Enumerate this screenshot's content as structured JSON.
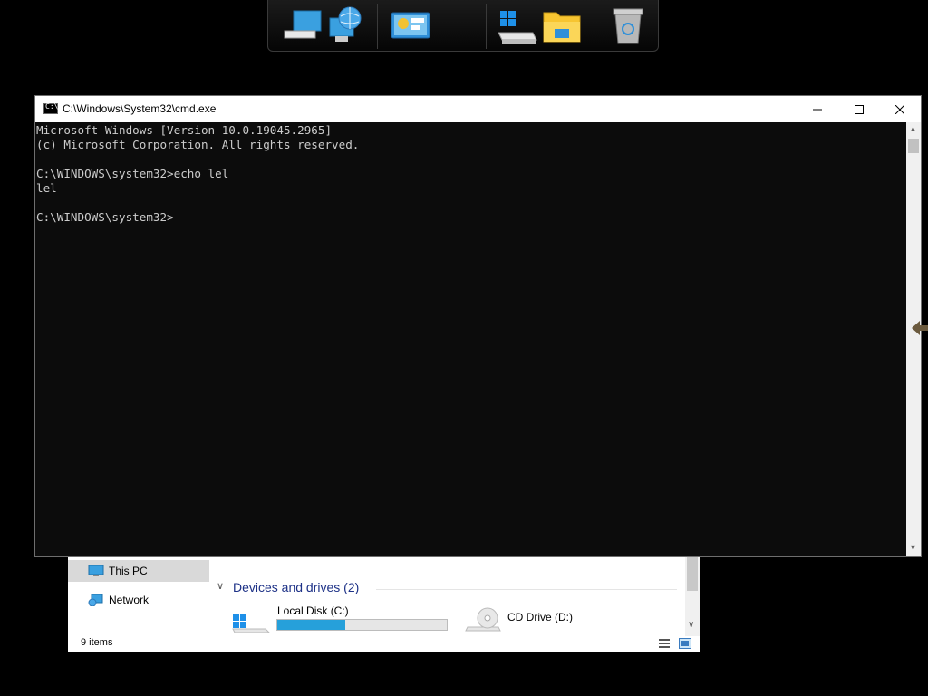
{
  "dock": {
    "items": [
      {
        "name": "computer-network-icon"
      },
      {
        "name": "control-panel-icon"
      },
      {
        "name": "drive-icon"
      },
      {
        "name": "folder-icon"
      },
      {
        "name": "recycle-bin-icon"
      }
    ]
  },
  "cmd": {
    "title": "C:\\Windows\\System32\\cmd.exe",
    "icon_label": "C:\\",
    "minimize": "—",
    "maximize": "☐",
    "close": "✕",
    "lines": [
      "Microsoft Windows [Version 10.0.19045.2965]",
      "(c) Microsoft Corporation. All rights reserved.",
      "",
      "C:\\WINDOWS\\system32>echo lel",
      "lel",
      "",
      "C:\\WINDOWS\\system32>"
    ],
    "scroll_up": "▲",
    "scroll_down": "▼"
  },
  "explorer": {
    "nav": [
      {
        "label": "This PC",
        "selected": true
      },
      {
        "label": "Network",
        "selected": false
      }
    ],
    "group_header": "Devices and drives (2)",
    "group_chevron": "∨",
    "drives": [
      {
        "label": "Local Disk (C:)",
        "usage_fraction": 0.4
      },
      {
        "label": "CD Drive (D:)"
      }
    ],
    "status": "9 items",
    "scroll_down": "∨"
  },
  "colors": {
    "console_bg": "#0c0c0c",
    "console_text": "#cccccc",
    "disk_bar": "#26a0da",
    "group_header": "#1e3287"
  }
}
